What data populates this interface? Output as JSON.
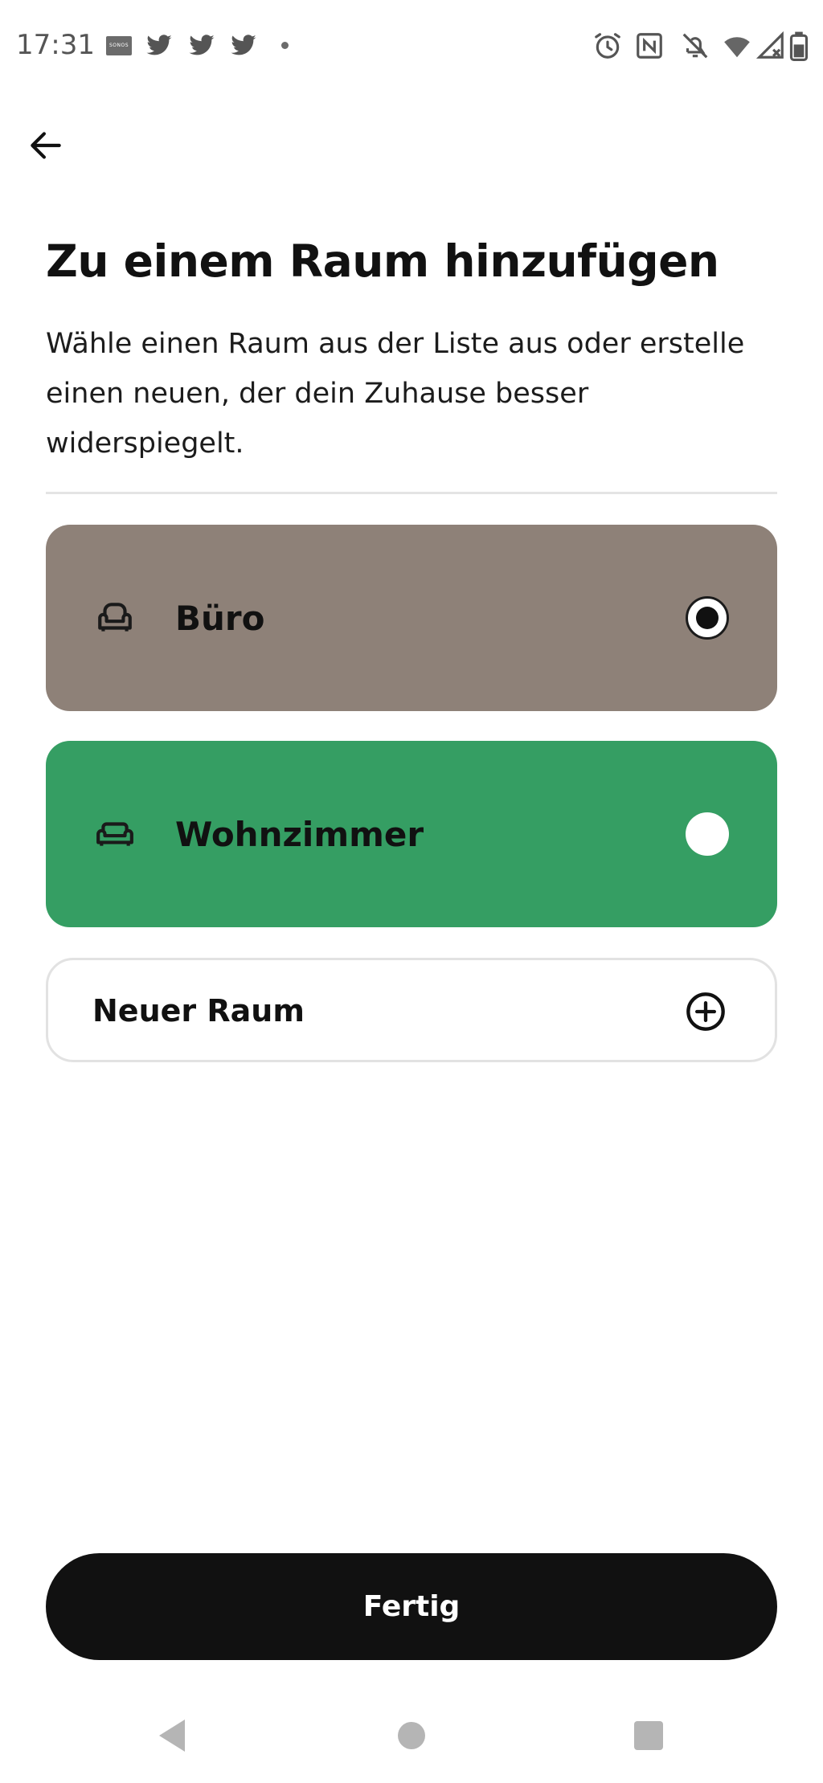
{
  "status_bar": {
    "time": "17:31",
    "icons": [
      "sonos-icon",
      "twitter-icon",
      "twitter-icon",
      "twitter-icon",
      "notification-dot-icon",
      "alarm-icon",
      "nfc-icon",
      "notifications-off-icon",
      "wifi-icon",
      "signal-icon",
      "battery-icon"
    ]
  },
  "header": {
    "back_icon": "arrow-left-icon",
    "title": "Zu einem Raum hinzufügen",
    "description": "Wähle einen Raum aus der Liste aus oder erstelle einen neuen, der dein Zuhause besser widerspiegelt."
  },
  "rooms": [
    {
      "label": "Büro",
      "icon": "armchair-icon",
      "selected": true,
      "color": "#8e8178"
    },
    {
      "label": "Wohnzimmer",
      "icon": "sofa-icon",
      "selected": false,
      "color": "#359e63"
    }
  ],
  "new_room": {
    "label": "Neuer Raum",
    "icon": "plus-circle-icon"
  },
  "footer": {
    "done_label": "Fertig"
  },
  "nav_bar": {
    "icons": [
      "nav-back-icon",
      "nav-home-icon",
      "nav-recents-icon"
    ]
  }
}
